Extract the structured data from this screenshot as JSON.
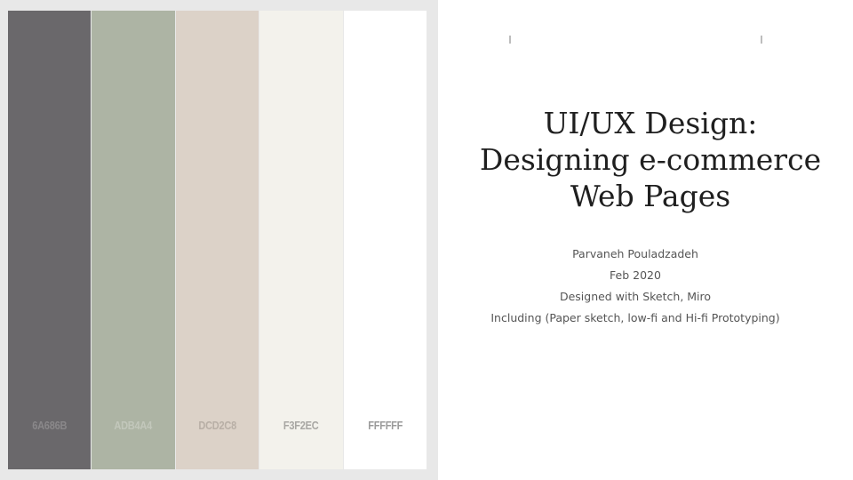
{
  "palette": {
    "swatches": [
      {
        "code": "6A686B",
        "color": "#6a686b",
        "text_color": "#8a888a"
      },
      {
        "code": "ADB4A4",
        "color": "#adb4a4",
        "text_color": "#c2c7bb"
      },
      {
        "code": "DCD2C8",
        "color": "#dcd2c8",
        "text_color": "#b8afa6"
      },
      {
        "code": "F3F2EC",
        "color": "#f3f2ec",
        "text_color": "#a8a7a3"
      },
      {
        "code": "FFFFFF",
        "color": "#ffffff",
        "text_color": "#9a9a9a"
      }
    ]
  },
  "title": {
    "line1": "UI/UX Design:",
    "line2": "Designing e-commerce",
    "line3": "Web Pages"
  },
  "subtitle": {
    "author": "Parvaneh Pouladzadeh",
    "date": "Feb  2020",
    "tools": "Designed with Sketch, Miro",
    "scope": "Including (Paper sketch, low-fi and Hi-fi Prototyping)"
  }
}
